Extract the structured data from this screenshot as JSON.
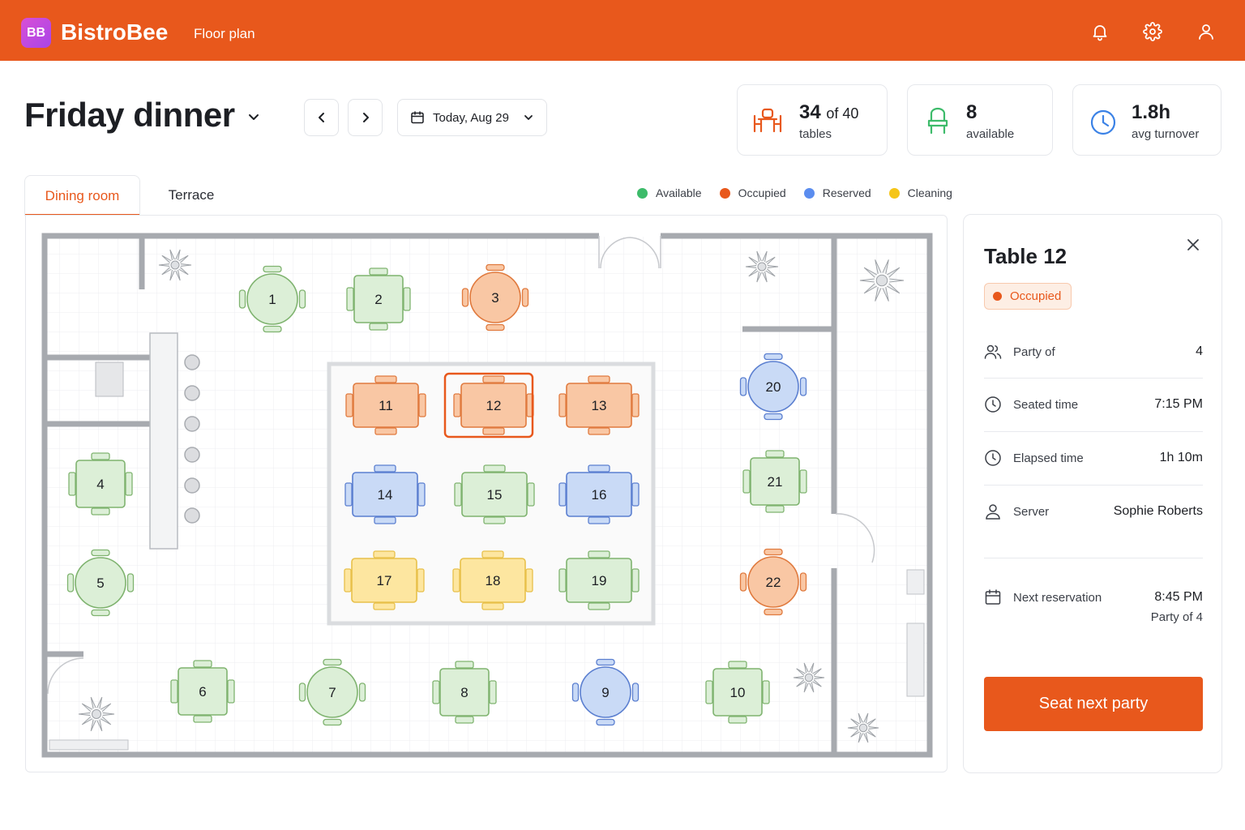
{
  "app": {
    "logo_text": "BB",
    "brand": "BistroBee",
    "section": "Floor plan"
  },
  "header": {
    "title": "Friday dinner",
    "date_label": "Today, Aug 29"
  },
  "stats": {
    "tables_count": "34",
    "tables_of": "of 40",
    "tables_label": "tables",
    "available_count": "8",
    "available_label": "available",
    "turnover_value": "1.8h",
    "turnover_label": "avg turnover"
  },
  "tabs": [
    {
      "label": "Dining room",
      "active": true
    },
    {
      "label": "Terrace",
      "active": false
    }
  ],
  "legend": [
    {
      "label": "Available",
      "color": "#3dbb6a"
    },
    {
      "label": "Occupied",
      "color": "#e8581c"
    },
    {
      "label": "Reserved",
      "color": "#5b8def"
    },
    {
      "label": "Cleaning",
      "color": "#f5c518"
    }
  ],
  "status_colors": {
    "available": {
      "fill": "#dcefd7",
      "stroke": "#7fb36f"
    },
    "occupied": {
      "fill": "#f9c7a4",
      "stroke": "#e07a3e"
    },
    "reserved": {
      "fill": "#c9daf6",
      "stroke": "#5b7fd0"
    },
    "cleaning": {
      "fill": "#fde6a0",
      "stroke": "#e8c04a"
    }
  },
  "floor_tables": [
    {
      "number": "1",
      "shape": "round",
      "status": "available"
    },
    {
      "number": "2",
      "shape": "square",
      "status": "available"
    },
    {
      "number": "3",
      "shape": "round",
      "status": "occupied"
    },
    {
      "number": "4",
      "shape": "square",
      "status": "available"
    },
    {
      "number": "5",
      "shape": "round",
      "status": "available"
    },
    {
      "number": "6",
      "shape": "square",
      "status": "available"
    },
    {
      "number": "7",
      "shape": "round",
      "status": "available"
    },
    {
      "number": "8",
      "shape": "square",
      "status": "available"
    },
    {
      "number": "9",
      "shape": "round",
      "status": "reserved"
    },
    {
      "number": "10",
      "shape": "square",
      "status": "available"
    },
    {
      "number": "11",
      "shape": "rect",
      "status": "occupied"
    },
    {
      "number": "12",
      "shape": "rect",
      "status": "occupied",
      "selected": true
    },
    {
      "number": "13",
      "shape": "rect",
      "status": "occupied"
    },
    {
      "number": "14",
      "shape": "rect",
      "status": "reserved"
    },
    {
      "number": "15",
      "shape": "rect",
      "status": "available"
    },
    {
      "number": "16",
      "shape": "rect",
      "status": "reserved"
    },
    {
      "number": "17",
      "shape": "rect",
      "status": "cleaning"
    },
    {
      "number": "18",
      "shape": "rect",
      "status": "cleaning"
    },
    {
      "number": "19",
      "shape": "rect",
      "status": "available"
    },
    {
      "number": "20",
      "shape": "round",
      "status": "reserved"
    },
    {
      "number": "21",
      "shape": "square",
      "status": "available"
    },
    {
      "number": "22",
      "shape": "round",
      "status": "occupied"
    }
  ],
  "detail": {
    "title": "Table 12",
    "status": "Occupied",
    "party_label": "Party of",
    "party_value": "4",
    "seated_label": "Seated time",
    "seated_value": "7:15 PM",
    "elapsed_label": "Elapsed time",
    "elapsed_value": "1h 10m",
    "server_label": "Server",
    "server_value": "Sophie Roberts",
    "next_label": "Next reservation",
    "next_time": "8:45 PM",
    "next_party": "Party of 4",
    "action_label": "Seat next party"
  }
}
